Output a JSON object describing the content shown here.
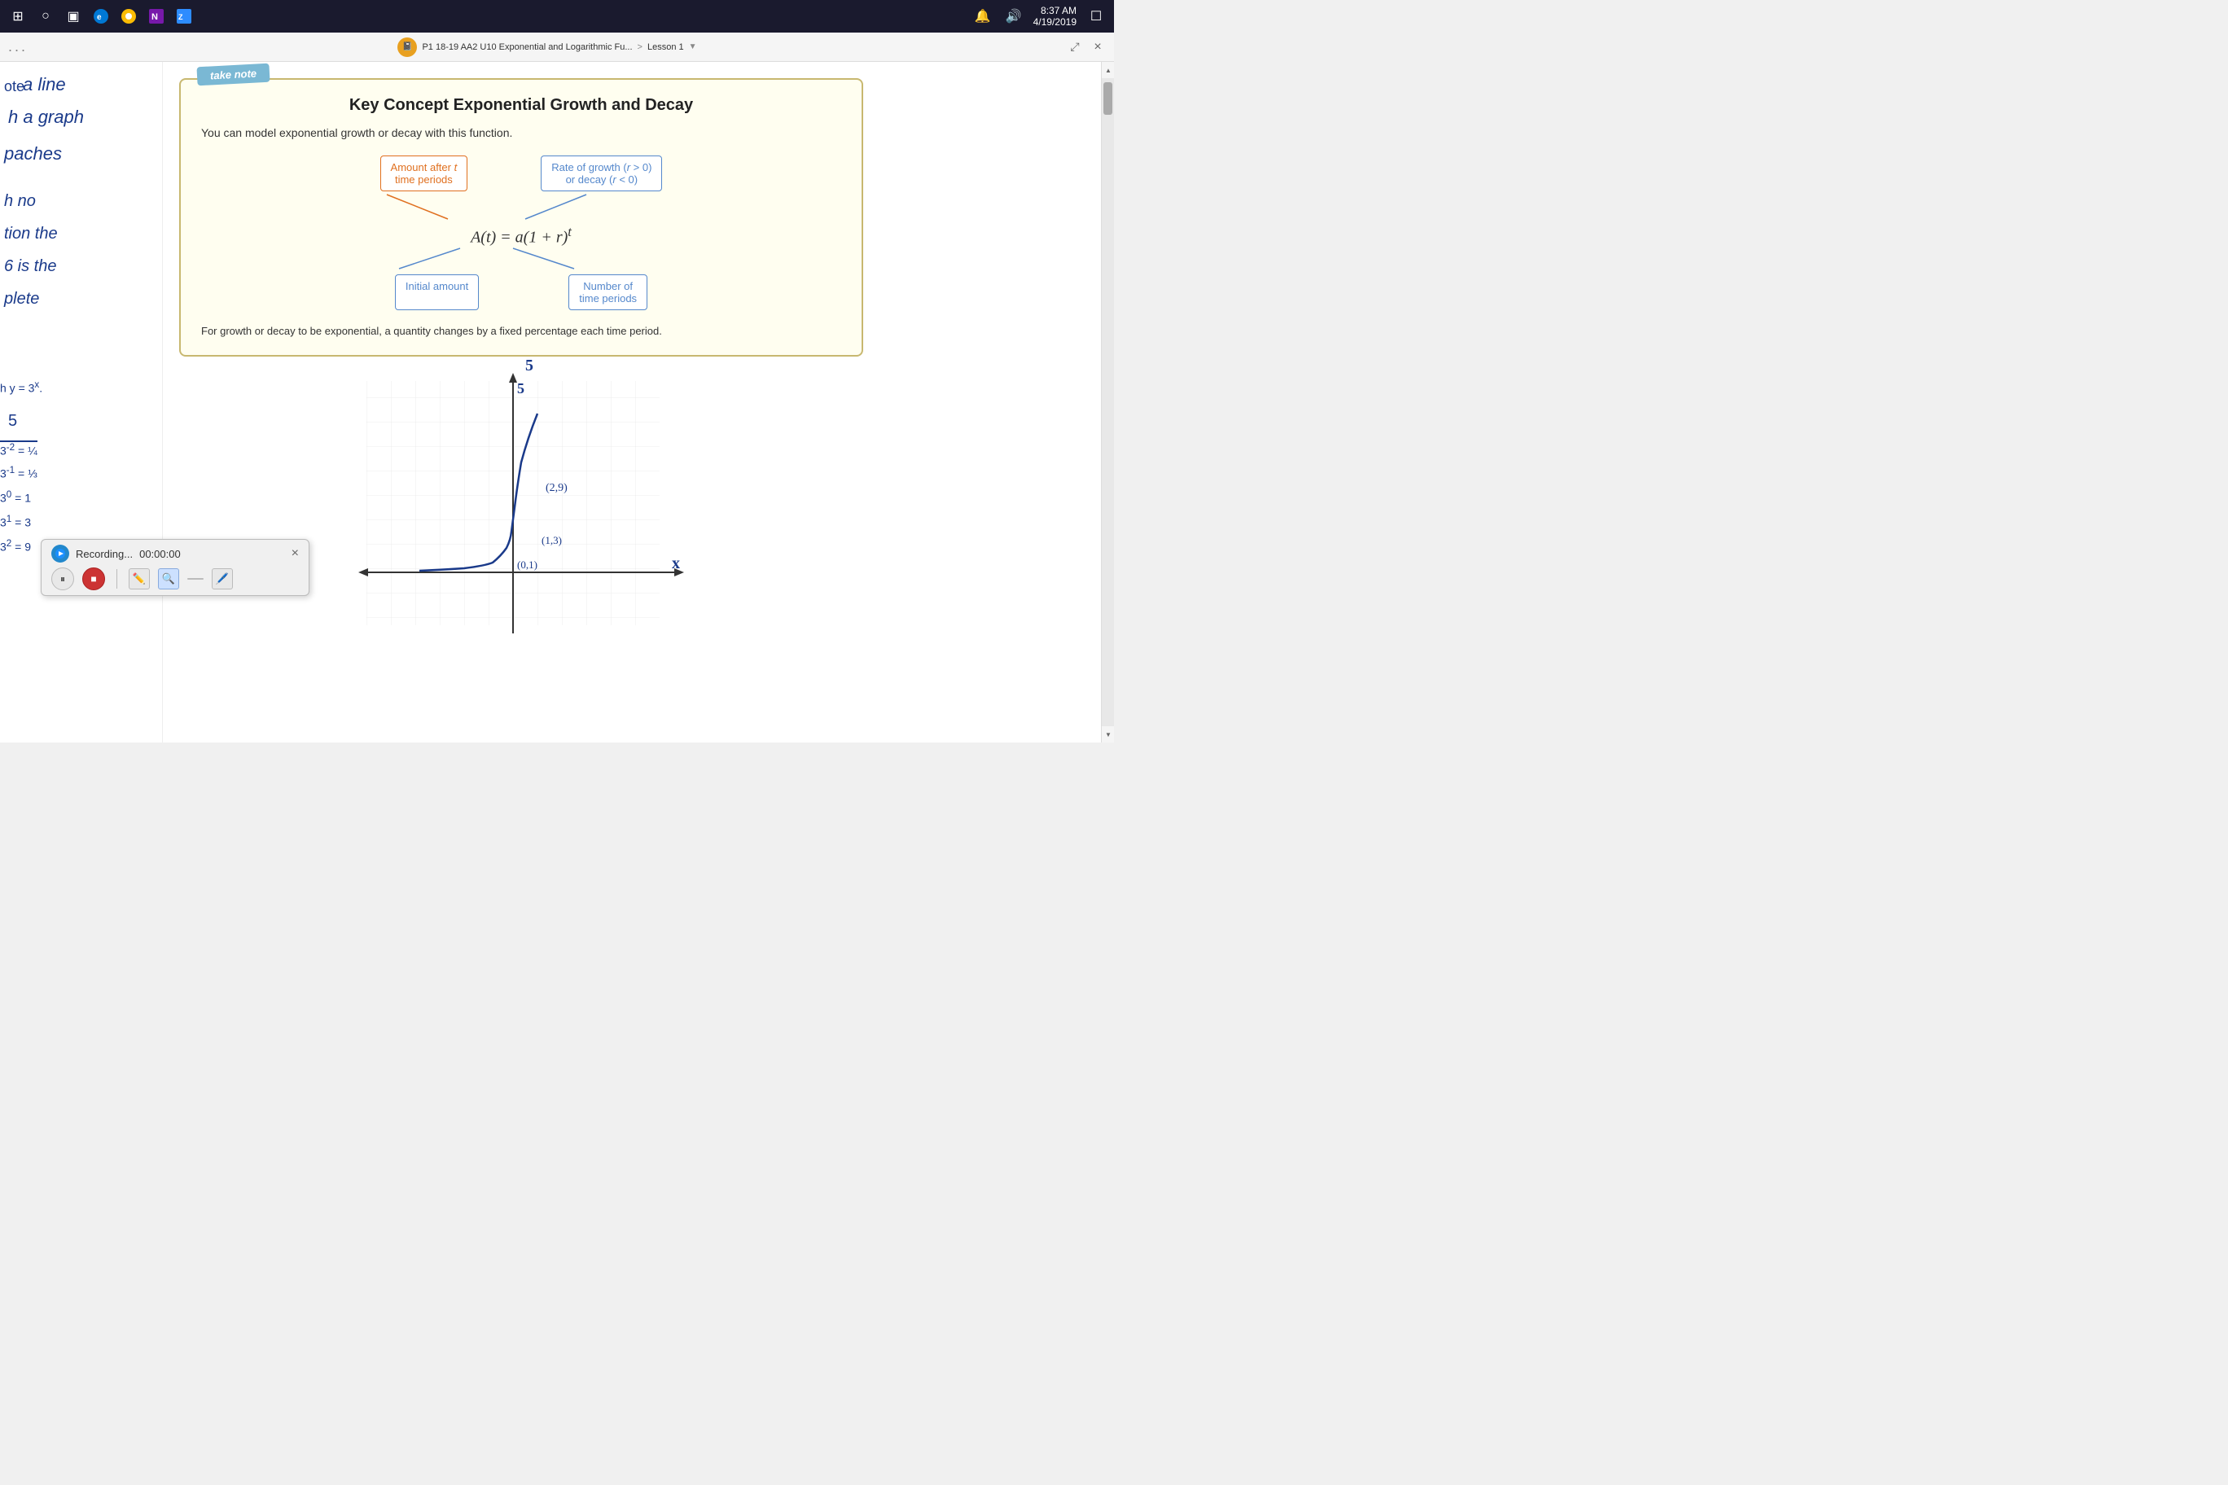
{
  "taskbar": {
    "time": "8:37 AM",
    "date": "4/19/2019",
    "start_icon": "⊞",
    "search_icon": "○",
    "task_icon": "▣"
  },
  "window": {
    "dots": "...",
    "breadcrumb": "P1 18-19 AA2 U10 Exponential and Logarithmic Fu...",
    "lesson": "Lesson 1",
    "close_label": "×"
  },
  "key_concept": {
    "take_note": "take note",
    "title": "Key Concept   Exponential Growth and Decay",
    "description": "You can model exponential growth or decay with this function.",
    "box1_label": "Amount after t\ntime periods",
    "box2_label": "Rate of growth (r > 0)\nor decay (r < 0)",
    "formula": "A(t) = a(1 + r)ᵗ",
    "box3_label": "Initial amount",
    "box4_label": "Number of\ntime periods",
    "footer": "For growth or decay to be exponential, a quantity changes by a fixed percentage each\ntime period."
  },
  "notes": {
    "line1": "a line",
    "line2": "a graph",
    "line3": "aches",
    "line4": "no",
    "line5": "tion the",
    "line6": "is the",
    "line7": "plete",
    "note_label": "ote",
    "graph_label": "h",
    "tion_label": "tion",
    "is_label": "6",
    "calc1": "3⁻² = ¼",
    "calc2": "3⁻¹ = ⅓",
    "calc3": "3⁰ = 1",
    "calc4": "3¹ = 3",
    "calc5": "3² = 9",
    "graph_eq": "h y = 3ˣ.",
    "num5_top": "5",
    "num5_bottom": "5"
  },
  "recording": {
    "status": "Recording...",
    "time": "00:00:00",
    "close_label": "×",
    "pause_label": "⏸",
    "stop_label": "■"
  },
  "graph": {
    "point1": "(2,9)",
    "point2": "(1,3)",
    "point3": "(0,1)",
    "x_label": "x",
    "y_value": "5"
  }
}
